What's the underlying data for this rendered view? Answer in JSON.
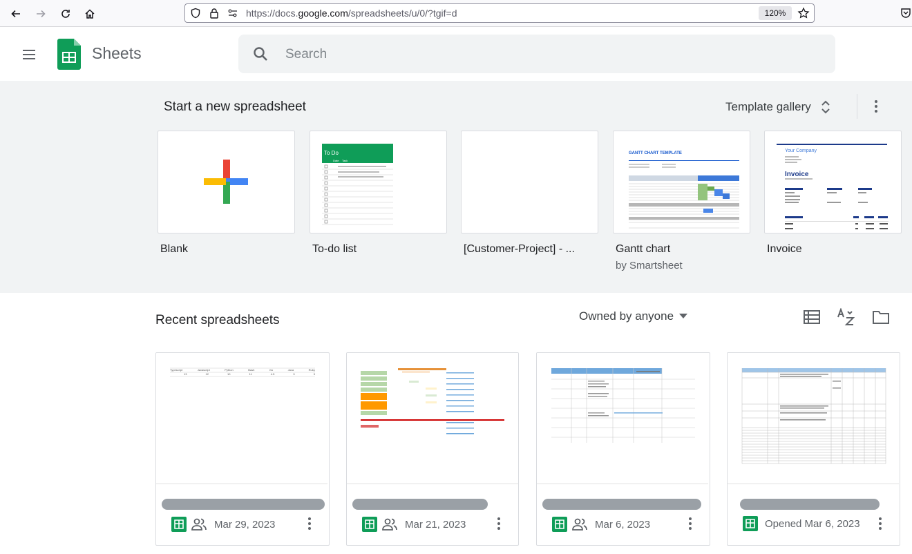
{
  "browser": {
    "url_prefix": "https://docs.",
    "url_domain": "google.com",
    "url_suffix": "/spreadsheets/u/0/?tgif=d",
    "zoom": "120%"
  },
  "header": {
    "app_title": "Sheets",
    "search_placeholder": "Search"
  },
  "templates": {
    "section_title": "Start a new spreadsheet",
    "gallery_label": "Template gallery",
    "items": [
      {
        "name": "Blank",
        "sub": ""
      },
      {
        "name": "To-do list",
        "sub": ""
      },
      {
        "name": "[Customer-Project] - ...",
        "sub": ""
      },
      {
        "name": "Gantt chart",
        "sub": "by Smartsheet"
      },
      {
        "name": "Invoice",
        "sub": ""
      }
    ],
    "todo_thumb": {
      "title": "To Do",
      "col_date": "Date",
      "col_task": "Task"
    },
    "gantt_thumb": {
      "title": "GANTT CHART TEMPLATE"
    },
    "invoice_thumb": {
      "company": "Your Company",
      "title": "Invoice"
    }
  },
  "recent": {
    "section_title": "Recent spreadsheets",
    "owner_filter": "Owned by anyone",
    "docs": [
      {
        "date": "Mar 29, 2023",
        "shared": true
      },
      {
        "date": "Mar 21, 2023",
        "shared": true
      },
      {
        "date": "Mar 6, 2023",
        "shared": true
      },
      {
        "date": "Opened Mar 6, 2023",
        "shared": false
      }
    ],
    "doc1_thumb": {
      "headers": [
        "Typescript",
        "Javascript",
        "Python",
        "Bash",
        "Go",
        "Java",
        "Ruby"
      ],
      "values": [
        "13",
        "12",
        "10",
        "11",
        "4.5",
        "9",
        "9"
      ]
    }
  },
  "colors": {
    "sheets_green": "#0f9d58",
    "accent_blue": "#4285f4",
    "accent_red": "#ea4335",
    "accent_yellow": "#fbbc04"
  }
}
